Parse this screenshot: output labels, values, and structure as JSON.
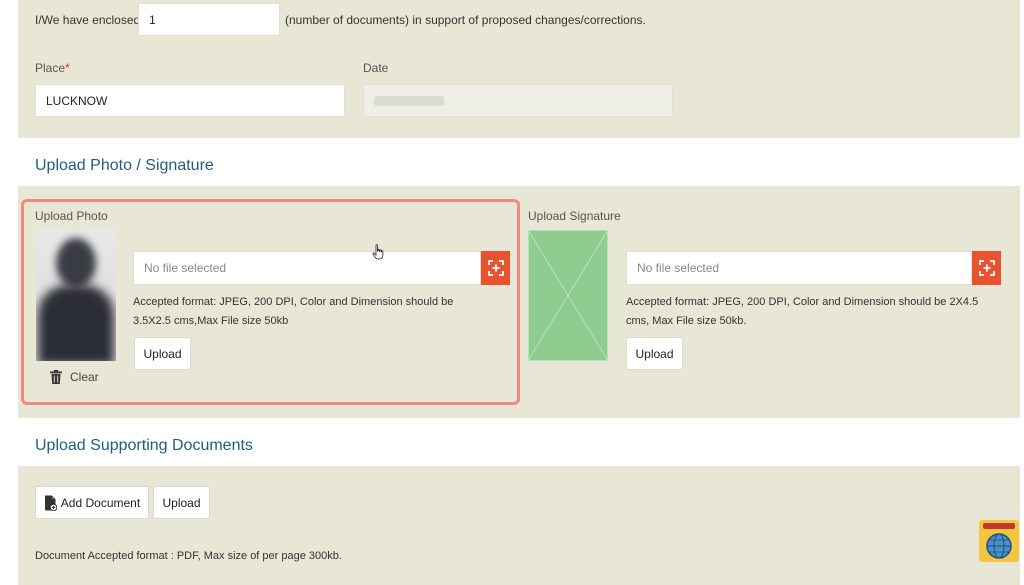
{
  "enclosed": {
    "label_prefix": "I/We have enclosed",
    "value": "1",
    "label_suffix": "(number of documents) in support of proposed changes/corrections."
  },
  "place": {
    "label": "Place",
    "required_mark": "*",
    "value": "LUCKNOW"
  },
  "date": {
    "label": "Date"
  },
  "photo_section": {
    "title": "Upload Photo / Signature",
    "photo": {
      "label": "Upload Photo",
      "file_placeholder": "No file selected",
      "help": "Accepted format: JPEG, 200 DPI, Color and Dimension should be 3.5X2.5 cms,Max File size 50kb",
      "upload_label": "Upload",
      "clear_label": "Clear"
    },
    "signature": {
      "label": "Upload Signature",
      "file_placeholder": "No file selected",
      "help": "Accepted format: JPEG, 200 DPI, Color and Dimension should be 2X4.5 cms, Max File size 50kb.",
      "upload_label": "Upload"
    }
  },
  "documents_section": {
    "title": "Upload Supporting Documents",
    "add_label": "Add Document",
    "upload_label": "Upload",
    "note": "Document Accepted format : PDF, Max size of per page 300kb."
  },
  "icons": {
    "file_select": "crosshair-select-icon",
    "clear": "trash-icon",
    "add_document": "document-add-icon",
    "watermark": "channel-logo-icon"
  },
  "colors": {
    "panel_bg": "#e8e6d4",
    "section_title": "#1f5f7a",
    "accent_orange": "#e8532f",
    "highlight_border": "#f08a80",
    "signature_placeholder": "#8fcc8f"
  }
}
